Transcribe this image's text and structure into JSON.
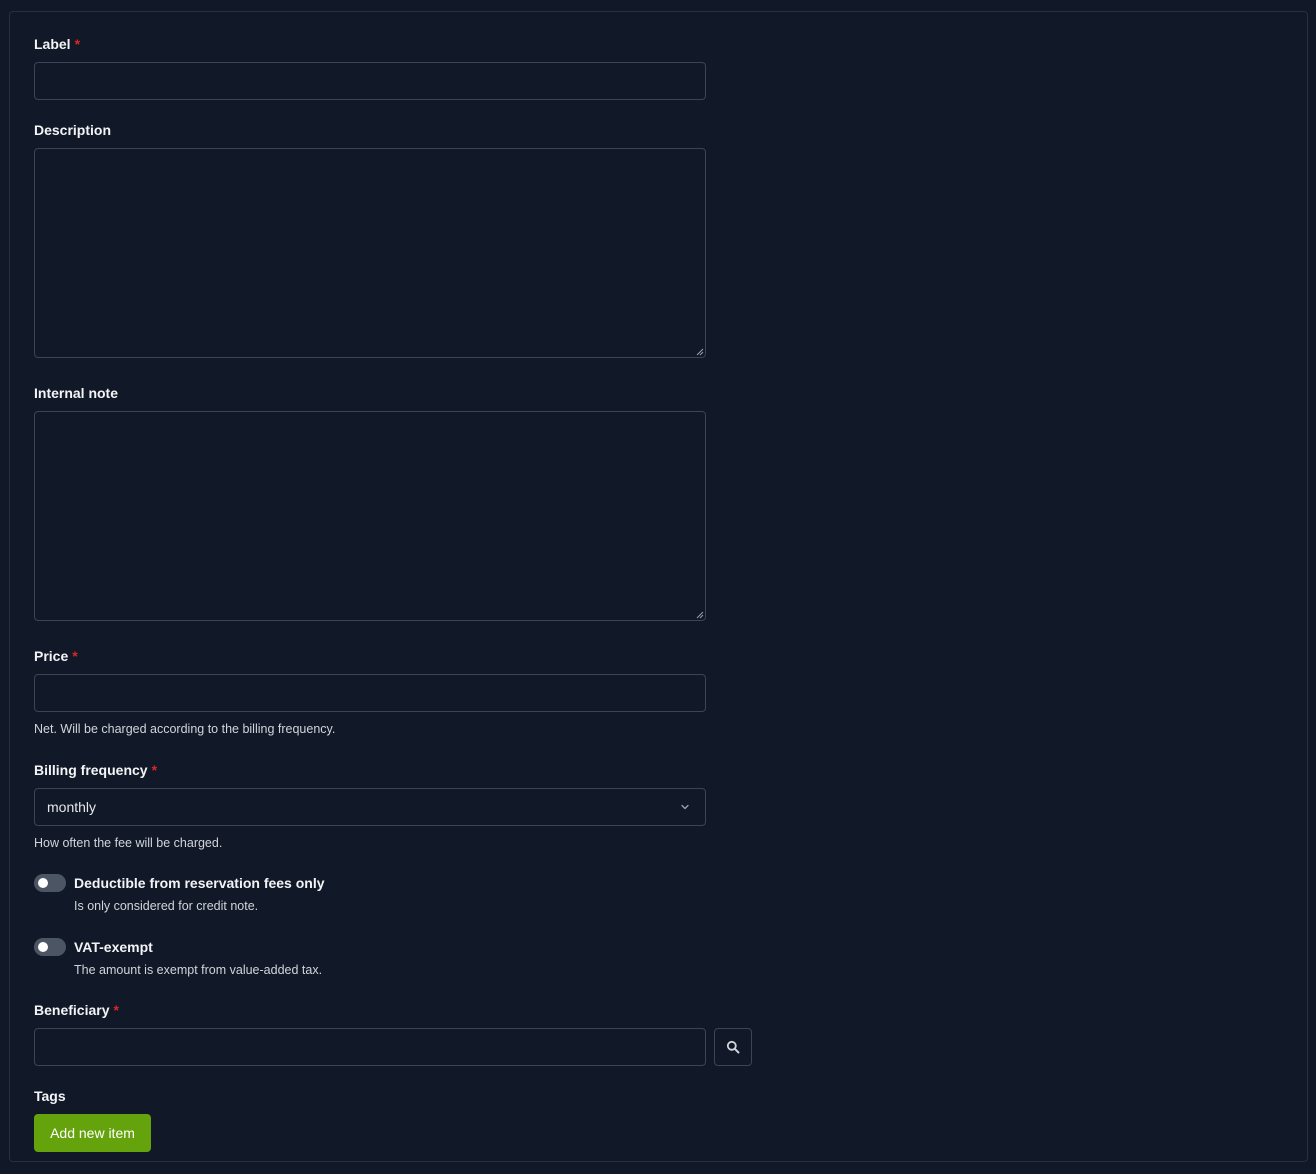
{
  "form": {
    "label": {
      "label": "Label",
      "required_mark": "*",
      "value": ""
    },
    "description": {
      "label": "Description",
      "value": ""
    },
    "internal_note": {
      "label": "Internal note",
      "value": ""
    },
    "price": {
      "label": "Price",
      "required_mark": "*",
      "value": "",
      "help": "Net. Will be charged according to the billing frequency."
    },
    "billing_frequency": {
      "label": "Billing frequency",
      "required_mark": "*",
      "selected": "monthly",
      "help": "How often the fee will be charged.",
      "icon": "chevron-down-icon"
    },
    "deductible": {
      "label": "Deductible from reservation fees only",
      "help": "Is only considered for credit note.",
      "checked": false
    },
    "vat_exempt": {
      "label": "VAT-exempt",
      "help": "The amount is exempt from value-added tax.",
      "checked": false
    },
    "beneficiary": {
      "label": "Beneficiary",
      "required_mark": "*",
      "value": "",
      "icon": "search-icon"
    },
    "tags": {
      "label": "Tags",
      "add_button": "Add new item"
    }
  },
  "colors": {
    "background": "#111827",
    "border": "#3b4554",
    "required": "#dc2626",
    "accent": "#65a30d",
    "toggle_off": "#4b5563"
  }
}
